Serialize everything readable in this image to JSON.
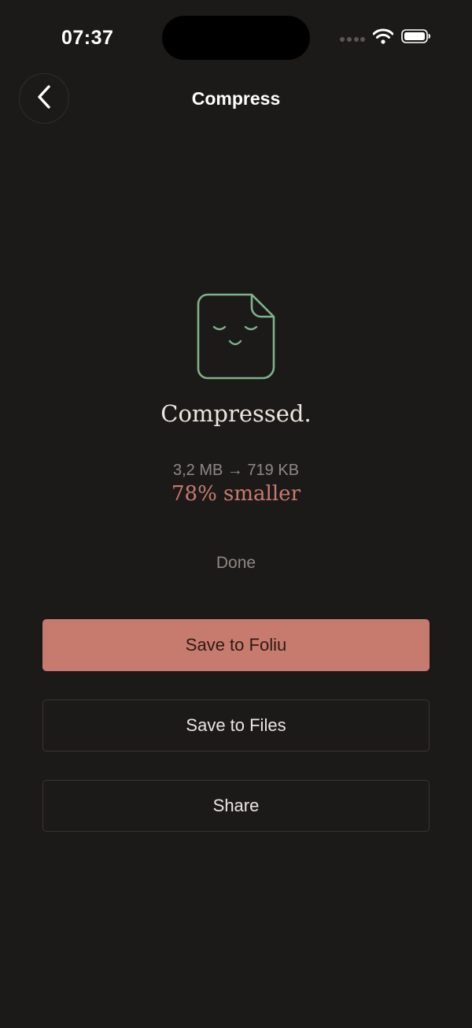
{
  "status_bar": {
    "time": "07:37",
    "icons": [
      "signal-dots-icon",
      "wifi-icon",
      "battery-icon"
    ]
  },
  "nav": {
    "title": "Compress",
    "back_icon": "chevron-left-icon"
  },
  "result": {
    "icon": "sleeping-document-icon",
    "headline": "Compressed.",
    "size_change": "3,2 MB → 719 KB",
    "savings": "78% smaller",
    "done_label": "Done"
  },
  "actions": {
    "save_to_foliu": "Save to Foliu",
    "save_to_files": "Save to Files",
    "share": "Share"
  },
  "colors": {
    "background": "#1c1a19",
    "accent": "#c77b6e",
    "icon_green": "#7fb28d",
    "muted_text": "#8e8883"
  }
}
